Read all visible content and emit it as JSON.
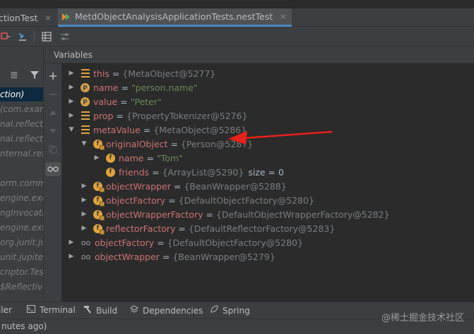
{
  "editor_tabs": [
    {
      "label": "ctionTest",
      "close": "×"
    },
    {
      "label": "MetdObjectAnalysisApplicationTests.nestTest",
      "close": "×"
    }
  ],
  "variables_title": "Variables",
  "frames": [
    {
      "label": "ction)",
      "selected": true
    },
    {
      "label": "(com.exam",
      "selected": false
    },
    {
      "label": "nal.reflect)",
      "selected": false
    },
    {
      "label": "nal.reflect)",
      "selected": false
    },
    {
      "label": "nternal.refle",
      "selected": false
    },
    {
      "label": "",
      "selected": false
    },
    {
      "label": "orm.commo",
      "selected": false
    },
    {
      "label": "engine.exec",
      "selected": false
    },
    {
      "label": "ngInvocatio",
      "selected": false
    },
    {
      "label": "engine.exte",
      "selected": false
    },
    {
      "label": "org.junit.ju",
      "selected": false
    },
    {
      "label": "unit.jupiter.",
      "selected": false
    },
    {
      "label": "criptor.Tes",
      "selected": false
    },
    {
      "label": "$Reflective",
      "selected": false
    }
  ],
  "variables": [
    {
      "name": "this",
      "value": "{MetaObject@5277}"
    },
    {
      "name": "name",
      "value": "\"person.name\""
    },
    {
      "name": "value",
      "value": "\"Peter\""
    },
    {
      "name": "prop",
      "value": "{PropertyTokenizer@5276}"
    },
    {
      "name": "metaValue",
      "value": "{MetaObject@5286}"
    },
    {
      "name": "originalObject",
      "value": "{Person@5287}"
    },
    {
      "name": "name",
      "value": "\"Tom\""
    },
    {
      "name": "friends",
      "value": "{ArrayList@5290}",
      "extra": "size = 0"
    },
    {
      "name": "objectWrapper",
      "value": "{BeanWrapper@5288}"
    },
    {
      "name": "objectFactory",
      "value": "{DefaultObjectFactory@5280}"
    },
    {
      "name": "objectWrapperFactory",
      "value": "{DefaultObjectWrapperFactory@5282}"
    },
    {
      "name": "reflectorFactory",
      "value": "{DefaultReflectorFactory@5283}"
    },
    {
      "name": "objectFactory",
      "value": "{DefaultObjectFactory@5280}"
    },
    {
      "name": "objectWrapper",
      "value": "{BeanWrapper@5279}"
    }
  ],
  "bottom_tools": [
    {
      "label": "iler",
      "icon": "problems-icon"
    },
    {
      "label": "Terminal",
      "icon": "terminal-icon"
    },
    {
      "label": "Build",
      "icon": "hammer-icon"
    },
    {
      "label": "Dependencies",
      "icon": "layers-icon"
    },
    {
      "label": "Spring",
      "icon": "leaf-icon"
    }
  ],
  "status_text": "nutes ago)",
  "watermark": "@稀土掘金技术社区",
  "colors": {
    "accent_tab": "#4a88c7",
    "arrow": "#e8211c",
    "var_name": "#cb7272",
    "string_value": "#6a8759",
    "object_value": "#7a7e80"
  }
}
